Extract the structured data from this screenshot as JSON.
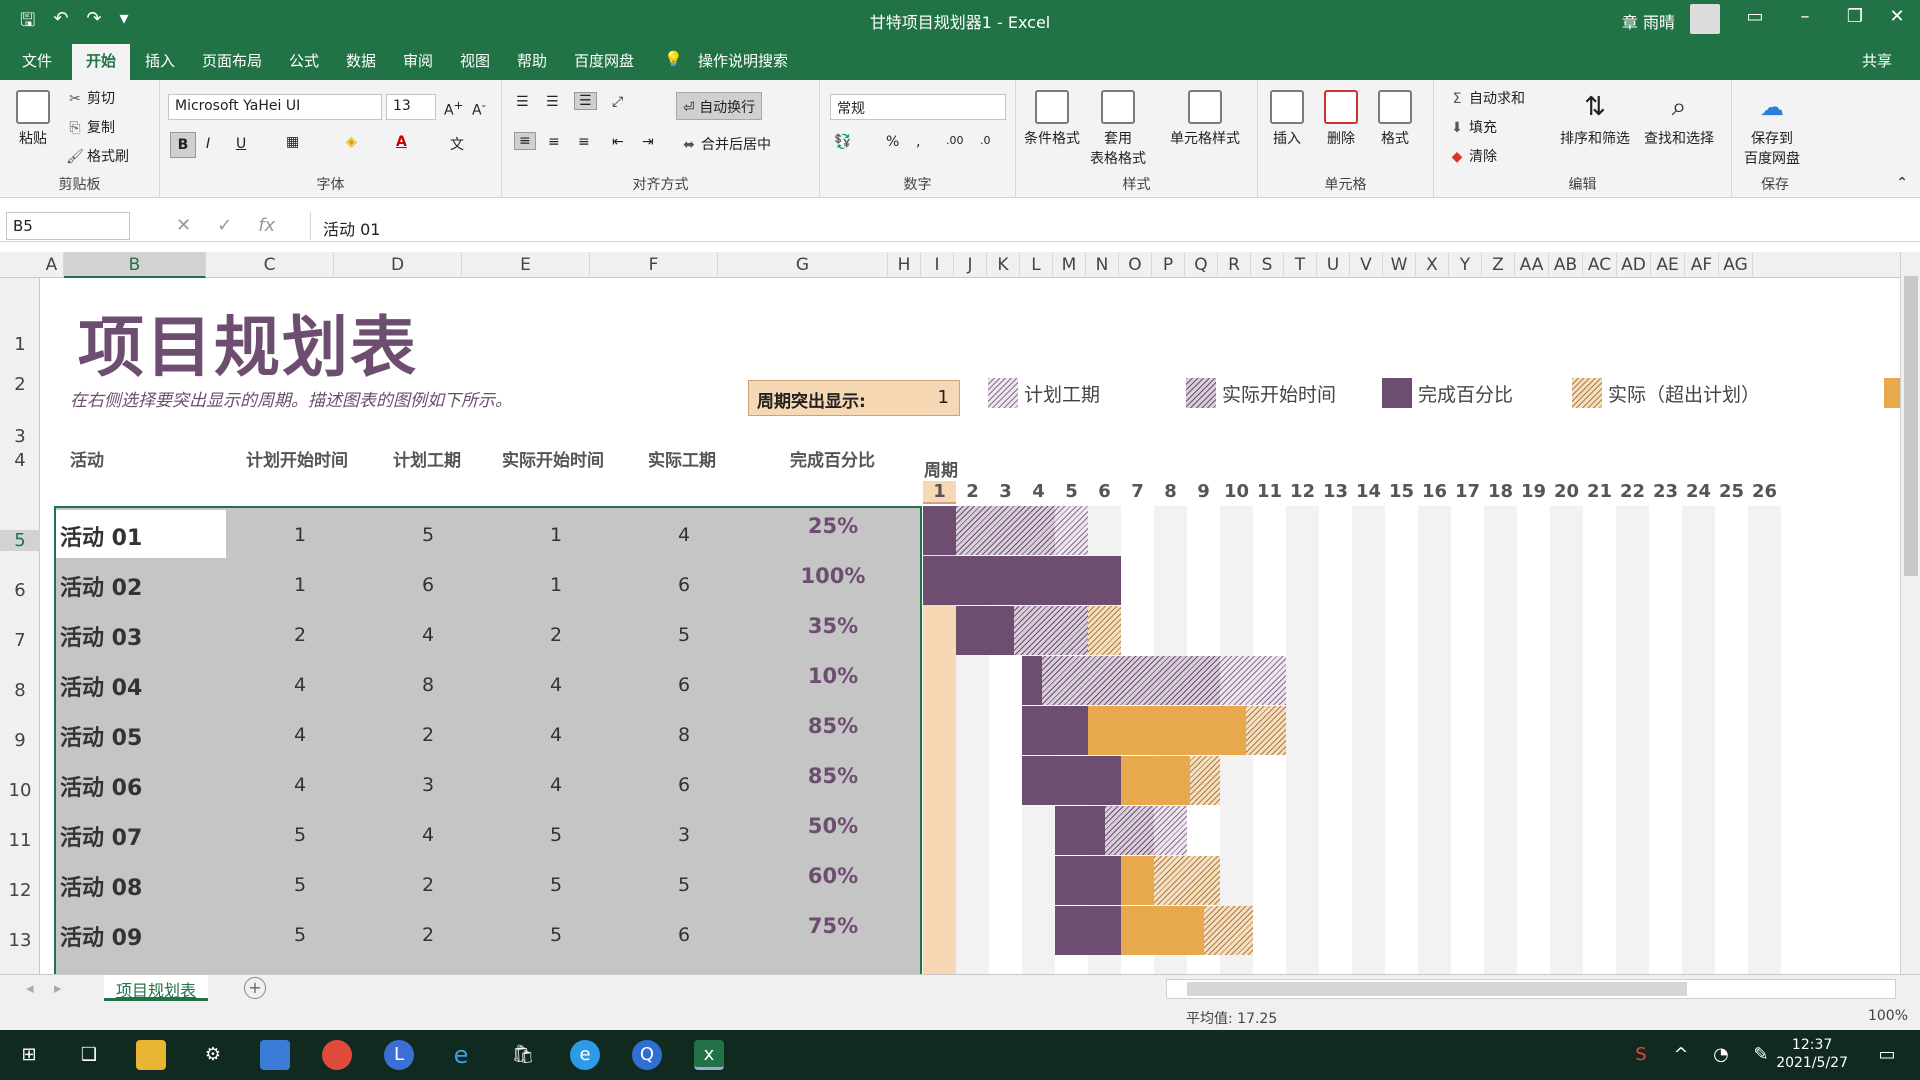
{
  "window": {
    "title": "甘特项目规划器1  -  Excel",
    "user": "章 雨晴",
    "share": "共享"
  },
  "tabs": [
    "文件",
    "开始",
    "插入",
    "页面布局",
    "公式",
    "数据",
    "审阅",
    "视图",
    "帮助",
    "百度网盘"
  ],
  "tell_me": "操作说明搜索",
  "ribbon": {
    "clipboard": {
      "paste": "粘贴",
      "cut": "剪切",
      "copy": "复制",
      "format_painter": "格式刷",
      "label": "剪贴板"
    },
    "font": {
      "name": "Microsoft YaHei UI",
      "size": "13",
      "label": "字体"
    },
    "alignment": {
      "wrap": "自动换行",
      "merge": "合并后居中",
      "label": "对齐方式"
    },
    "number": {
      "format": "常规",
      "label": "数字"
    },
    "styles": {
      "conditional": "条件格式",
      "table_line1": "套用",
      "table_line2": "表格格式",
      "cell_styles": "单元格样式",
      "label": "样式"
    },
    "cells": {
      "insert": "插入",
      "delete": "删除",
      "format": "格式",
      "label": "单元格"
    },
    "editing": {
      "autosum": "自动求和",
      "fill": "填充",
      "clear": "清除",
      "sort": "排序和筛选",
      "find": "查找和选择",
      "label": "编辑"
    },
    "save": {
      "line1": "保存到",
      "line2": "百度网盘",
      "label": "保存"
    }
  },
  "formula_bar": {
    "name_box": "B5",
    "formula": "活动 01"
  },
  "columns": [
    "A",
    "B",
    "C",
    "D",
    "E",
    "F",
    "G",
    "H",
    "I",
    "J",
    "K",
    "L",
    "M",
    "N",
    "O",
    "P",
    "Q",
    "R",
    "S",
    "T",
    "U",
    "V",
    "W",
    "X",
    "Y",
    "Z",
    "AA",
    "AB",
    "AC",
    "AD",
    "AE",
    "AF",
    "AG"
  ],
  "rows": [
    "1",
    "2",
    "3",
    "4",
    "5",
    "6",
    "7",
    "8",
    "9",
    "10",
    "11",
    "12",
    "13"
  ],
  "sheet": {
    "title": "项目规划表",
    "subtitle": "在右侧选择要突出显示的周期。描述图表的图例如下所示。",
    "period_highlight_label": "周期突出显示:",
    "period_highlight_value": "1",
    "legend": {
      "planned": "计划工期",
      "actual_start": "实际开始时间",
      "percent_complete": "完成百分比",
      "actual_over": "实际（超出计划）"
    },
    "headers": {
      "activity": "活动",
      "plan_start": "计划开始时间",
      "plan_duration": "计划工期",
      "actual_start": "实际开始时间",
      "actual_duration": "实际工期",
      "percent": "完成百分比"
    },
    "period_label": "周期",
    "periods": [
      "1",
      "2",
      "3",
      "4",
      "5",
      "6",
      "7",
      "8",
      "9",
      "10",
      "11",
      "12",
      "13",
      "14",
      "15",
      "16",
      "17",
      "18",
      "19",
      "20",
      "21",
      "22",
      "23",
      "24",
      "25",
      "26"
    ],
    "activities": [
      {
        "name": "活动 01",
        "plan_start": "1",
        "plan_duration": "5",
        "actual_start": "1",
        "actual_duration": "4",
        "percent": "25%",
        "pct_value": 0.25
      },
      {
        "name": "活动 02",
        "plan_start": "1",
        "plan_duration": "6",
        "actual_start": "1",
        "actual_duration": "6",
        "percent": "100%",
        "pct_value": 1.0
      },
      {
        "name": "活动 03",
        "plan_start": "2",
        "plan_duration": "4",
        "actual_start": "2",
        "actual_duration": "5",
        "percent": "35%",
        "pct_value": 0.35
      },
      {
        "name": "活动 04",
        "plan_start": "4",
        "plan_duration": "8",
        "actual_start": "4",
        "actual_duration": "6",
        "percent": "10%",
        "pct_value": 0.1
      },
      {
        "name": "活动 05",
        "plan_start": "4",
        "plan_duration": "2",
        "actual_start": "4",
        "actual_duration": "8",
        "percent": "85%",
        "pct_value": 0.85
      },
      {
        "name": "活动 06",
        "plan_start": "4",
        "plan_duration": "3",
        "actual_start": "4",
        "actual_duration": "6",
        "percent": "85%",
        "pct_value": 0.85
      },
      {
        "name": "活动 07",
        "plan_start": "5",
        "plan_duration": "4",
        "actual_start": "5",
        "actual_duration": "3",
        "percent": "50%",
        "pct_value": 0.5
      },
      {
        "name": "活动 08",
        "plan_start": "5",
        "plan_duration": "2",
        "actual_start": "5",
        "actual_duration": "5",
        "percent": "60%",
        "pct_value": 0.6
      },
      {
        "name": "活动 09",
        "plan_start": "5",
        "plan_duration": "2",
        "actual_start": "5",
        "actual_duration": "6",
        "percent": "75%",
        "pct_value": 0.75
      }
    ]
  },
  "sheet_tab": "项目规划表",
  "status": {
    "avg": "平均值: 17.25",
    "zoom": "100%"
  },
  "clock": {
    "time": "12:37",
    "date": "2021/5/27"
  },
  "colors": {
    "excel_green": "#217346",
    "purple": "#6d4e70",
    "orange": "#e8a94e",
    "peach": "#f7d8b4"
  }
}
